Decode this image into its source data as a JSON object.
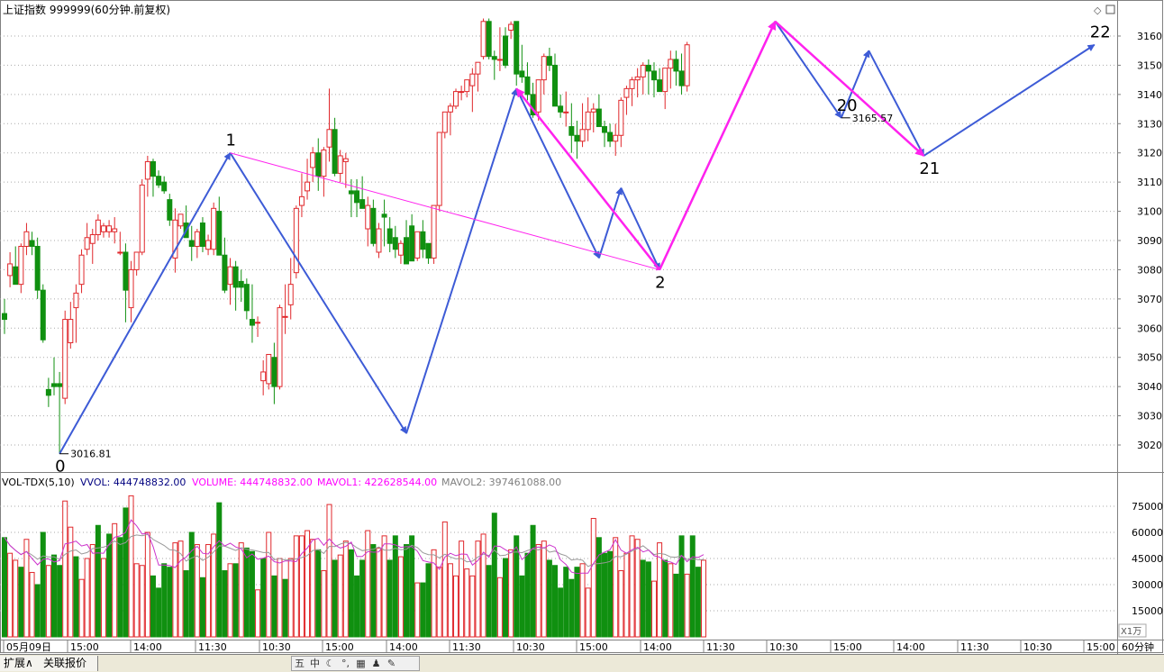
{
  "header": {
    "title": "上证指数 999999(60分钟.前复权)",
    "corner_icons": [
      "diamond-icon",
      "restore-icon"
    ]
  },
  "price_axis": {
    "ticks": [
      3020,
      3030,
      3040,
      3050,
      3060,
      3070,
      3080,
      3090,
      3100,
      3110,
      3120,
      3130,
      3140,
      3150,
      3160
    ]
  },
  "volume_axis": {
    "ticks": [
      15000,
      30000,
      45000,
      60000,
      75000
    ],
    "unit": "X1万"
  },
  "indicator": {
    "name": "VOL-TDX(5,10)",
    "vvol": "VVOL: 444748832.00",
    "volume": "VOLUME: 444748832.00",
    "mavol1": "MAVOL1: 422628544.00",
    "mavol2": "MAVOL2: 397461088.00"
  },
  "time_axis": {
    "labels": [
      "05月09日",
      "15:00",
      "14:00",
      "11:30",
      "10:30",
      "15:00",
      "14:00",
      "11:30",
      "10:30",
      "15:00",
      "14:00",
      "11:30",
      "10:30",
      "15:00",
      "14:00",
      "11:30",
      "10:30",
      "15:00"
    ],
    "period": "60分钟"
  },
  "chart_data": {
    "type": "candlestick",
    "title": "上证指数 999999(60分钟.前复权)",
    "ylim": [
      3014,
      3168
    ],
    "candles": [
      [
        3065,
        3070,
        3058,
        3063
      ],
      [
        3078,
        3086,
        3074,
        3082
      ],
      [
        3081,
        3088,
        3075,
        3075
      ],
      [
        3075,
        3089,
        3072,
        3088
      ],
      [
        3088,
        3096,
        3085,
        3093
      ],
      [
        3090,
        3093,
        3085,
        3088
      ],
      [
        3088,
        3091,
        3070,
        3073
      ],
      [
        3073,
        3075,
        3055,
        3056
      ],
      [
        3039,
        3043,
        3033,
        3037
      ],
      [
        3041,
        3050,
        3037,
        3040
      ],
      [
        3041,
        3045,
        3017,
        3040
      ],
      [
        3036,
        3066,
        3034,
        3063
      ],
      [
        3055,
        3069,
        3053,
        3063
      ],
      [
        3067,
        3075,
        3055,
        3072
      ],
      [
        3075,
        3087,
        3072,
        3085
      ],
      [
        3087,
        3096,
        3085,
        3091
      ],
      [
        3089,
        3094,
        3082,
        3092
      ],
      [
        3092,
        3099,
        3090,
        3097
      ],
      [
        3093,
        3096,
        3091,
        3095
      ],
      [
        3093,
        3097,
        3091,
        3095
      ],
      [
        3093,
        3098,
        3089,
        3094
      ],
      [
        3086,
        3093,
        3085,
        3086
      ],
      [
        3086,
        3089,
        3062,
        3073
      ],
      [
        3067,
        3083,
        3062,
        3080
      ],
      [
        3080,
        3086,
        3078,
        3086
      ],
      [
        3086,
        3111,
        3085,
        3109
      ],
      [
        3111,
        3119,
        3105,
        3117
      ],
      [
        3117,
        3118,
        3105,
        3112
      ],
      [
        3112,
        3114,
        3108,
        3109
      ],
      [
        3110,
        3112,
        3106,
        3107
      ],
      [
        3104,
        3106,
        3095,
        3097
      ],
      [
        3084,
        3101,
        3079,
        3097
      ],
      [
        3095,
        3099,
        3094,
        3099
      ],
      [
        3096,
        3102,
        3092,
        3091
      ],
      [
        3090,
        3095,
        3083,
        3088
      ],
      [
        3088,
        3094,
        3084,
        3093
      ],
      [
        3096,
        3098,
        3086,
        3088
      ],
      [
        3087,
        3092,
        3085,
        3090
      ],
      [
        3087,
        3103,
        3085,
        3101
      ],
      [
        3100,
        3105,
        3086,
        3085
      ],
      [
        3085,
        3091,
        3072,
        3073
      ],
      [
        3075,
        3084,
        3068,
        3081
      ],
      [
        3081,
        3083,
        3066,
        3074
      ],
      [
        3076,
        3080,
        3069,
        3074
      ],
      [
        3075,
        3077,
        3063,
        3066
      ],
      [
        3063,
        3075,
        3055,
        3061
      ],
      [
        3062,
        3064,
        3057,
        3062
      ],
      [
        3042,
        3049,
        3037,
        3045
      ],
      [
        3041,
        3051,
        3039,
        3051
      ],
      [
        3050,
        3055,
        3034,
        3040
      ],
      [
        3040,
        3068,
        3039,
        3067
      ],
      [
        3064,
        3075,
        3058,
        3064
      ],
      [
        3068,
        3084,
        3063,
        3075
      ],
      [
        3079,
        3102,
        3077,
        3101
      ],
      [
        3102,
        3113,
        3098,
        3105
      ],
      [
        3107,
        3118,
        3104,
        3110
      ],
      [
        3115,
        3122,
        3110,
        3120
      ],
      [
        3120,
        3125,
        3107,
        3112
      ],
      [
        3112,
        3122,
        3105,
        3121
      ],
      [
        3122,
        3142,
        3117,
        3128
      ],
      [
        3128,
        3132,
        3112,
        3113
      ],
      [
        3113,
        3121,
        3110,
        3119
      ],
      [
        3117,
        3120,
        3108,
        3118
      ],
      [
        3107,
        3111,
        3098,
        3106
      ],
      [
        3107,
        3111,
        3098,
        3103
      ],
      [
        3104,
        3112,
        3101,
        3101
      ],
      [
        3094,
        3105,
        3088,
        3102
      ],
      [
        3101,
        3104,
        3088,
        3089
      ],
      [
        3086,
        3096,
        3084,
        3094
      ],
      [
        3099,
        3104,
        3088,
        3098
      ],
      [
        3094,
        3098,
        3086,
        3089
      ],
      [
        3091,
        3095,
        3084,
        3087
      ],
      [
        3085,
        3090,
        3082,
        3089
      ],
      [
        3091,
        3097,
        3086,
        3082
      ],
      [
        3095,
        3099,
        3083,
        3083
      ],
      [
        3084,
        3093,
        3083,
        3093
      ],
      [
        3093,
        3097,
        3084,
        3087
      ],
      [
        3089,
        3089,
        3082,
        3084
      ],
      [
        3084,
        3102,
        3082,
        3102
      ],
      [
        3102,
        3127,
        3100,
        3127
      ],
      [
        3127,
        3134,
        3125,
        3134
      ],
      [
        3134,
        3137,
        3126,
        3136
      ],
      [
        3136,
        3142,
        3135,
        3141
      ],
      [
        3141,
        3143,
        3138,
        3141
      ],
      [
        3141,
        3145,
        3139,
        3145
      ],
      [
        3143,
        3149,
        3134,
        3147
      ],
      [
        3147,
        3151,
        3141,
        3151
      ],
      [
        3153,
        3166,
        3152,
        3165
      ],
      [
        3165,
        3166,
        3152,
        3153
      ],
      [
        3153,
        3155,
        3145,
        3152
      ],
      [
        3152,
        3163,
        3148,
        3152
      ],
      [
        3160,
        3163,
        3149,
        3150
      ],
      [
        3162,
        3165,
        3159,
        3164
      ],
      [
        3165,
        3165,
        3143,
        3147
      ],
      [
        3148,
        3157,
        3144,
        3146
      ],
      [
        3146,
        3151,
        3138,
        3140
      ],
      [
        3140,
        3144,
        3132,
        3133
      ],
      [
        3134,
        3145,
        3131,
        3145
      ],
      [
        3145,
        3154,
        3140,
        3153
      ],
      [
        3153,
        3156,
        3148,
        3150
      ],
      [
        3150,
        3154,
        3136,
        3136
      ],
      [
        3136,
        3140,
        3132,
        3134
      ],
      [
        3134,
        3141,
        3129,
        3134
      ],
      [
        3129,
        3137,
        3120,
        3126
      ],
      [
        3126,
        3131,
        3118,
        3124
      ],
      [
        3124,
        3137,
        3122,
        3128
      ],
      [
        3128,
        3139,
        3124,
        3134
      ],
      [
        3134,
        3137,
        3127,
        3135
      ],
      [
        3135,
        3140,
        3130,
        3129
      ],
      [
        3129,
        3131,
        3122,
        3127
      ],
      [
        3127,
        3130,
        3122,
        3124
      ],
      [
        3124,
        3130,
        3119,
        3126
      ],
      [
        3126,
        3139,
        3122,
        3138
      ],
      [
        3139,
        3143,
        3133,
        3142
      ],
      [
        3142,
        3146,
        3136,
        3145
      ],
      [
        3145,
        3149,
        3139,
        3146
      ],
      [
        3146,
        3151,
        3140,
        3150
      ],
      [
        3150,
        3152,
        3140,
        3148
      ],
      [
        3148,
        3151,
        3139,
        3145
      ],
      [
        3145,
        3149,
        3141,
        3141
      ],
      [
        3141,
        3149,
        3135,
        3149
      ],
      [
        3149,
        3155,
        3142,
        3152
      ],
      [
        3152,
        3155,
        3143,
        3148
      ],
      [
        3148,
        3154,
        3140,
        3143
      ],
      [
        3143,
        3158,
        3141,
        3157
      ]
    ],
    "volume": [
      57,
      48,
      44,
      40,
      56,
      37,
      30,
      60,
      41,
      47,
      41,
      78,
      63,
      46,
      33,
      45,
      53,
      64,
      45,
      59,
      65,
      57,
      74,
      81,
      42,
      41,
      60,
      35,
      28,
      42,
      40,
      54,
      55,
      38,
      60,
      53,
      34,
      53,
      59,
      77,
      38,
      42,
      42,
      54,
      51,
      49,
      27,
      45,
      60,
      35,
      45,
      33,
      45,
      58,
      58,
      61,
      56,
      50,
      38,
      76,
      44,
      47,
      55,
      50,
      35,
      44,
      61,
      53,
      51,
      58,
      44,
      58,
      46,
      53,
      58,
      31,
      31,
      42,
      50,
      40,
      66,
      42,
      35,
      55,
      39,
      35,
      55,
      59,
      41,
      71,
      34,
      45,
      50,
      58,
      35,
      48,
      64,
      53,
      55,
      44,
      41,
      28,
      40,
      33,
      40,
      42,
      28,
      68,
      57,
      48,
      49,
      57,
      38,
      48,
      58,
      56,
      44,
      43,
      32,
      54,
      44,
      42,
      36,
      58,
      36,
      58,
      40,
      44
    ],
    "volume_up": [
      false,
      true,
      true,
      false,
      true,
      true,
      false,
      false,
      true,
      false,
      false,
      true,
      true,
      false,
      true,
      true,
      true,
      false,
      true,
      false,
      true,
      false,
      false,
      true,
      true,
      true,
      true,
      false,
      false,
      false,
      false,
      true,
      true,
      false,
      false,
      true,
      false,
      true,
      true,
      false,
      false,
      true,
      false,
      true,
      false,
      false,
      true,
      false,
      true,
      false,
      true,
      false,
      true,
      true,
      true,
      true,
      true,
      false,
      true,
      true,
      false,
      true,
      true,
      false,
      false,
      false,
      true,
      false,
      true,
      true,
      false,
      false,
      true,
      false,
      false,
      true,
      false,
      false,
      true,
      true,
      true,
      true,
      true,
      true,
      true,
      true,
      true,
      true,
      false,
      false,
      true,
      false,
      true,
      false,
      false,
      false,
      false,
      true,
      true,
      false,
      false,
      false,
      false,
      false,
      false,
      true,
      true,
      true,
      false,
      false,
      false,
      true,
      true,
      true,
      true,
      true,
      false,
      false,
      true,
      true,
      false,
      true,
      false,
      false,
      true,
      false,
      false,
      true
    ],
    "annotations": [
      {
        "label": "0",
        "price": "3016.81"
      },
      {
        "label": "1"
      },
      {
        "label": "2"
      },
      {
        "label": "20",
        "price": "3165.57"
      },
      {
        "label": "21"
      },
      {
        "label": "22"
      }
    ],
    "wave_lines": {
      "blue": [
        [
          10,
          3017
        ],
        [
          41,
          3120
        ],
        [
          73,
          3024
        ],
        [
          93,
          3142
        ],
        [
          108,
          3084
        ],
        [
          112,
          3108
        ],
        [
          119,
          3080
        ],
        [
          140,
          3165
        ],
        [
          152,
          3132
        ],
        [
          157,
          3155
        ],
        [
          167,
          3119
        ],
        [
          198,
          3157
        ]
      ],
      "magenta": [
        [
          41,
          3120
        ],
        [
          119,
          3080
        ],
        [
          93,
          3142
        ],
        [
          119,
          3080
        ],
        [
          140,
          3165
        ],
        [
          167,
          3119
        ]
      ]
    },
    "colors": {
      "up": "#e0272b",
      "down": "#109010",
      "blue_line": "#3d5bd6",
      "magenta_line": "#ff22ee",
      "mavol1": "#cc33cc",
      "mavol2": "#999999",
      "vvol_text": "#000080",
      "volume_text": "#ff00ff",
      "mavol2_text": "#808080"
    }
  },
  "statusbar": {
    "tab_expand": "扩展∧",
    "tab_related": "关联报价",
    "tool_icons": [
      "stock-icon",
      "chinese-input-icon",
      "moon-icon",
      "punctuation-icon",
      "keyboard-icon",
      "user-icon",
      "wrench-icon"
    ],
    "tool_glyphs": [
      "五",
      "中",
      "☾",
      "°,",
      "▦",
      "♟",
      "✎"
    ]
  }
}
